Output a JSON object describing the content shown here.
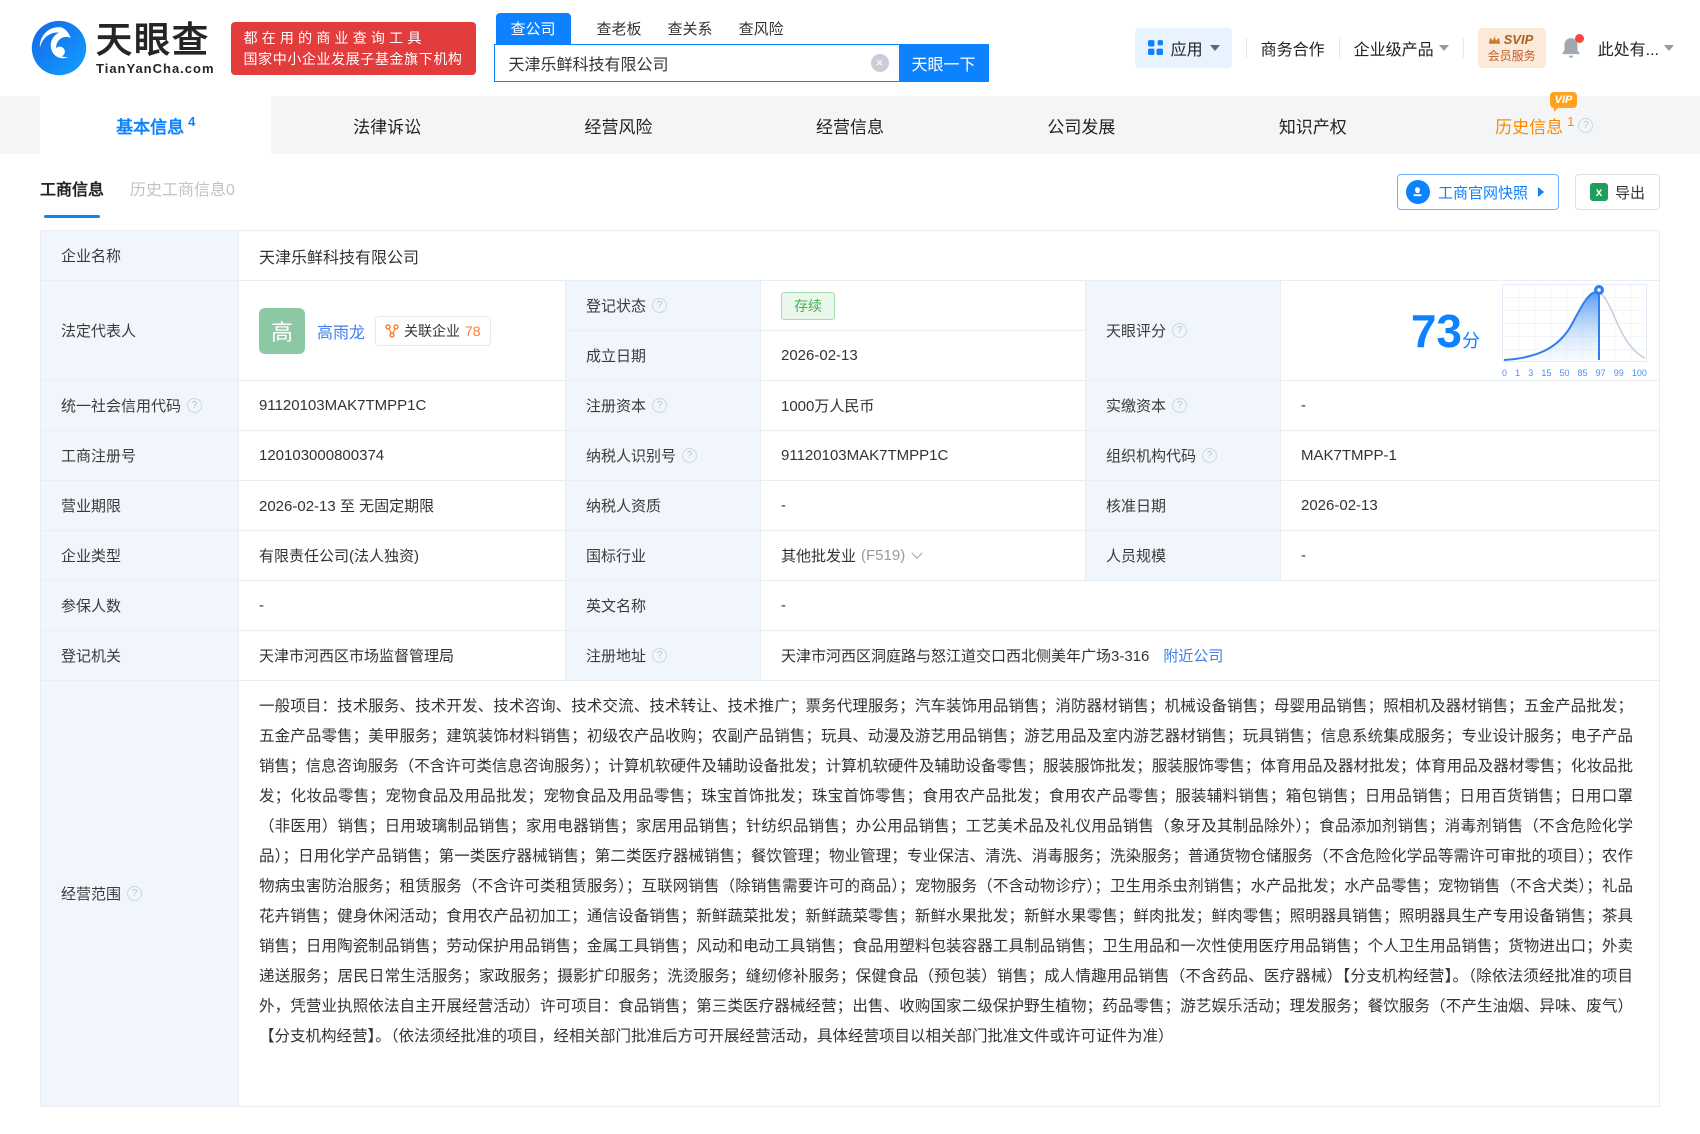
{
  "header": {
    "logo": {
      "brand": "天眼查",
      "domain": "TianYanCha.com"
    },
    "slogan_line1": "都在用的商业查询工具",
    "slogan_line2": "国家中小企业发展子基金旗下机构",
    "search": {
      "tabs": [
        {
          "label": "查公司"
        },
        {
          "label": "查老板"
        },
        {
          "label": "查关系"
        },
        {
          "label": "查风险"
        }
      ],
      "value": "天津乐鲜科技有限公司",
      "button": "天眼一下"
    },
    "nav": {
      "apps": "应用",
      "cooperation": "商务合作",
      "enterprise": "企业级产品",
      "svip_line1": "SVIP",
      "svip_line2": "会员服务",
      "more": "此处有..."
    }
  },
  "tabs": [
    {
      "label": "基本信息",
      "count": "4"
    },
    {
      "label": "法律诉讼"
    },
    {
      "label": "经营风险"
    },
    {
      "label": "经营信息"
    },
    {
      "label": "公司发展"
    },
    {
      "label": "知识产权"
    },
    {
      "label": "历史信息",
      "count": "1",
      "vip": "VIP"
    }
  ],
  "subtabs": {
    "active": "工商信息",
    "inactive": "历史工商信息0"
  },
  "actions": {
    "snapshot": "工商官网快照",
    "export": "导出"
  },
  "score": {
    "value": "73",
    "unit": "分",
    "label": "天眼评分",
    "ticks": [
      "0",
      "1",
      "3",
      "15",
      "50",
      "85",
      "97",
      "99",
      "100"
    ]
  },
  "table": {
    "company_name": {
      "label": "企业名称",
      "value": "天津乐鲜科技有限公司"
    },
    "legal_rep": {
      "label": "法定代表人",
      "avatar": "高",
      "name": "高雨龙",
      "related_label": "关联企业",
      "related_count": "78"
    },
    "reg_status": {
      "label": "登记状态",
      "value": "存续"
    },
    "est_date": {
      "label": "成立日期",
      "value": "2026-02-13"
    },
    "uscc": {
      "label": "统一社会信用代码",
      "value": "91120103MAK7TMPP1C"
    },
    "reg_capital": {
      "label": "注册资本",
      "value": "1000万人民币"
    },
    "paid_capital": {
      "label": "实缴资本",
      "value": "-"
    },
    "reg_number": {
      "label": "工商注册号",
      "value": "120103000800374"
    },
    "taxpayer_id": {
      "label": "纳税人识别号",
      "value": "91120103MAK7TMPP1C"
    },
    "org_code": {
      "label": "组织机构代码",
      "value": "MAK7TMPP-1"
    },
    "business_term": {
      "label": "营业期限",
      "value": "2026-02-13 至 无固定期限"
    },
    "taxpayer_quality": {
      "label": "纳税人资质",
      "value": "-"
    },
    "approval_date": {
      "label": "核准日期",
      "value": "2026-02-13"
    },
    "company_type": {
      "label": "企业类型",
      "value": "有限责任公司(法人独资)"
    },
    "industry": {
      "label": "国标行业",
      "value": "其他批发业",
      "code": "(F519)"
    },
    "staff_size": {
      "label": "人员规模",
      "value": "-"
    },
    "insured_count": {
      "label": "参保人数",
      "value": "-"
    },
    "english_name": {
      "label": "英文名称",
      "value": "-"
    },
    "reg_authority": {
      "label": "登记机关",
      "value": "天津市河西区市场监督管理局"
    },
    "reg_address": {
      "label": "注册地址",
      "value": "天津市河西区洞庭路与怒江道交口西北侧美年广场3-316",
      "nearby": "附近公司"
    },
    "business_scope": {
      "label": "经营范围",
      "value": "一般项目：技术服务、技术开发、技术咨询、技术交流、技术转让、技术推广；票务代理服务；汽车装饰用品销售；消防器材销售；机械设备销售；母婴用品销售；照相机及器材销售；五金产品批发；五金产品零售；美甲服务；建筑装饰材料销售；初级农产品收购；农副产品销售；玩具、动漫及游艺用品销售；游艺用品及室内游艺器材销售；玩具销售；信息系统集成服务；专业设计服务；电子产品销售；信息咨询服务（不含许可类信息咨询服务）；计算机软硬件及辅助设备批发；计算机软硬件及辅助设备零售；服装服饰批发；服装服饰零售；体育用品及器材批发；体育用品及器材零售；化妆品批发；化妆品零售；宠物食品及用品批发；宠物食品及用品零售；珠宝首饰批发；珠宝首饰零售；食用农产品批发；食用农产品零售；服装辅料销售；箱包销售；日用品销售；日用百货销售；日用口罩（非医用）销售；日用玻璃制品销售；家用电器销售；家居用品销售；针纺织品销售；办公用品销售；工艺美术品及礼仪用品销售（象牙及其制品除外）；食品添加剂销售；消毒剂销售（不含危险化学品）；日用化学产品销售；第一类医疗器械销售；第二类医疗器械销售；餐饮管理；物业管理；专业保洁、清洗、消毒服务；洗染服务；普通货物仓储服务（不含危险化学品等需许可审批的项目）；农作物病虫害防治服务；租赁服务（不含许可类租赁服务）；互联网销售（除销售需要许可的商品）；宠物服务（不含动物诊疗）；卫生用杀虫剂销售；水产品批发；水产品零售；宠物销售（不含犬类）；礼品花卉销售；健身休闲活动；食用农产品初加工；通信设备销售；新鲜蔬菜批发；新鲜蔬菜零售；新鲜水果批发；新鲜水果零售；鲜肉批发；鲜肉零售；照明器具销售；照明器具生产专用设备销售；茶具销售；日用陶瓷制品销售；劳动保护用品销售；金属工具销售；风动和电动工具销售；食品用塑料包装容器工具制品销售；卫生用品和一次性使用医疗用品销售；个人卫生用品销售；货物进出口；外卖递送服务；居民日常生活服务；家政服务；摄影扩印服务；洗烫服务；缝纫修补服务；保健食品（预包装）销售；成人情趣用品销售（不含药品、医疗器械）【分支机构经营】。（除依法须经批准的项目外，凭营业执照依法自主开展经营活动）许可项目：食品销售；第三类医疗器械经营；出售、收购国家二级保护野生植物；药品零售；游艺娱乐活动；理发服务；餐饮服务（不产生油烟、异味、废气）【分支机构经营】。（依法须经批准的项目，经相关部门批准后方可开展经营活动，具体经营项目以相关部门批准文件或许可证件为准）"
    }
  },
  "colors": {
    "primary": "#0d82ff",
    "link": "#3e7ef0",
    "brand_red": "#e23c3c",
    "status_green": "#44b24e",
    "orange": "#ff8a00"
  }
}
